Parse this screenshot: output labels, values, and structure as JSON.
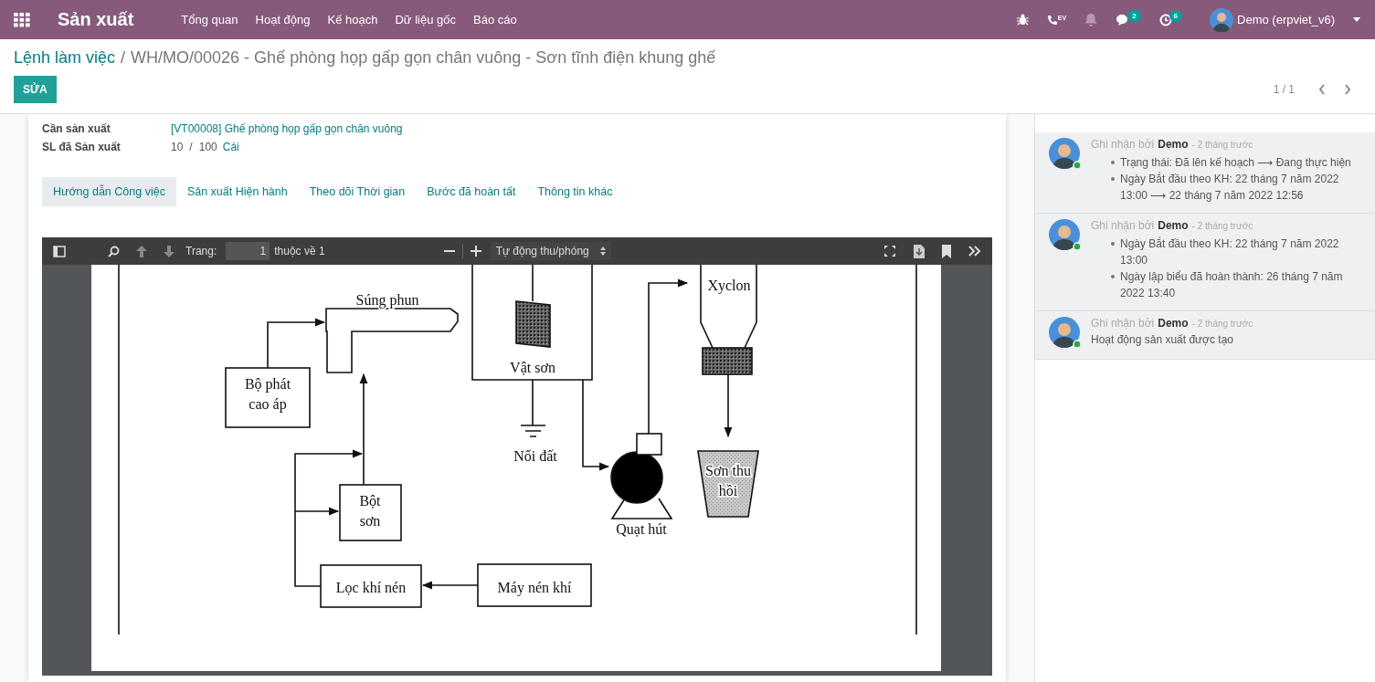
{
  "app": {
    "title": "Sản xuất",
    "menu": [
      "Tổng quan",
      "Hoạt động",
      "Kế hoạch",
      "Dữ liệu gốc",
      "Báo cáo"
    ]
  },
  "systray": {
    "phone_badge": "EV",
    "chat_count": "2",
    "activity_count": "6",
    "user": "Demo (erpviet_v6)"
  },
  "breadcrumb": {
    "parent": "Lệnh làm việc",
    "separator": "/",
    "current": "WH/MO/00026 - Ghế phòng họp gấp gọn chân vuông - Sơn tĩnh điện khung ghế"
  },
  "edit_button": "SỬA",
  "pager": "1 / 1",
  "fields": [
    {
      "label": "Cần sản xuất",
      "kind": "link",
      "value": "[VT00008] Ghế phòng họp gấp gọn chân vuông"
    },
    {
      "label": "SL đã Sản xuất",
      "kind": "quantity",
      "value": "10",
      "separator": "/",
      "total": "100",
      "unit": "Cái"
    }
  ],
  "tabs": [
    {
      "label": "Hướng dẫn Công việc",
      "selected": true
    },
    {
      "label": "Sản xuất Hiện hành",
      "selected": false
    },
    {
      "label": "Theo dõi Thời gian",
      "selected": false
    },
    {
      "label": "Bước đã hoàn tất",
      "selected": false
    },
    {
      "label": "Thông tin khác",
      "selected": false
    }
  ],
  "pdf_viewer": {
    "page_label": "Trang:",
    "page": "1",
    "page_total": "thuộc về 1",
    "zoom": "Tự động thu/phóng"
  },
  "diagram": {
    "labels": [
      {
        "lines": [
          "Xyclon"
        ]
      },
      {
        "lines": [
          "Súng phun"
        ]
      },
      {
        "lines": [
          "Vật sơn"
        ]
      },
      {
        "lines": [
          "Bộ phát",
          "cao áp"
        ]
      },
      {
        "lines": [
          "Nối đất"
        ]
      },
      {
        "lines": [
          "Sơn thu",
          "hồi"
        ]
      },
      {
        "lines": [
          "Bột",
          "sơn"
        ]
      },
      {
        "lines": [
          "Quạt hút"
        ]
      },
      {
        "lines": [
          "Lọc khí nén"
        ]
      },
      {
        "lines": [
          "Máy nén khí"
        ]
      }
    ]
  },
  "chatter": [
    {
      "prefix": "Ghi nhận bởi",
      "author": "Demo",
      "time": "- 2 tháng trước",
      "kind": "changes",
      "items": [
        "Trạng thái: Đã lên kế hoạch ⟶ Đang thực hiện",
        "Ngày Bắt đầu theo KH: 22 tháng 7 năm 2022 13:00 ⟶ 22 tháng 7 năm 2022 12:56"
      ]
    },
    {
      "prefix": "Ghi nhận bởi",
      "author": "Demo",
      "time": "- 2 tháng trước",
      "kind": "changes",
      "items": [
        "Ngày Bắt đầu theo KH: 22 tháng 7 năm 2022 13:00",
        "Ngày lập biểu đã hoàn thành: 26 tháng 7 năm 2022 13:40"
      ]
    },
    {
      "prefix": "Ghi nhận bởi",
      "author": "Demo",
      "time": "- 2 tháng trước",
      "kind": "note",
      "body": "Hoạt động sản xuất được tạo"
    }
  ]
}
